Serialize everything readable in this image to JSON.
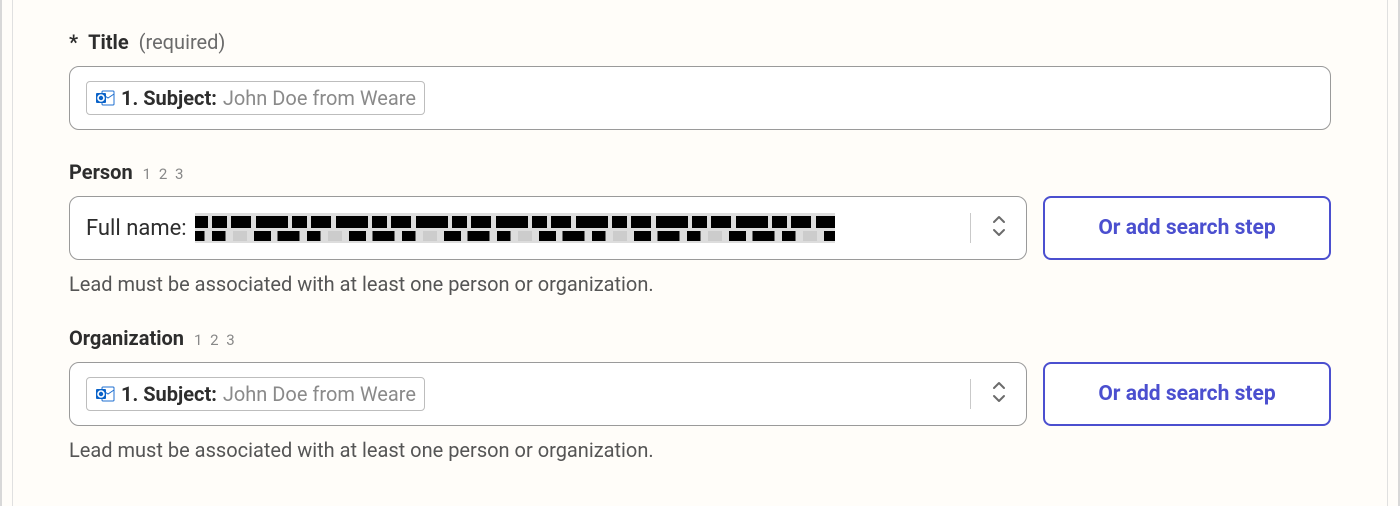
{
  "title": {
    "asterisk": "*",
    "label": "Title",
    "hint": "(required)",
    "pill_prefix": "1. Subject:",
    "pill_value": "John Doe from Weare"
  },
  "person": {
    "label": "Person",
    "nums": "1 2 3",
    "fullname_label": "Full name:",
    "button": "Or add search step",
    "help": "Lead must be associated with at least one person or organization."
  },
  "organization": {
    "label": "Organization",
    "nums": "1 2 3",
    "pill_prefix": "1. Subject:",
    "pill_value": "John Doe from Weare",
    "button": "Or add search step",
    "help": "Lead must be associated with at least one person or organization."
  }
}
